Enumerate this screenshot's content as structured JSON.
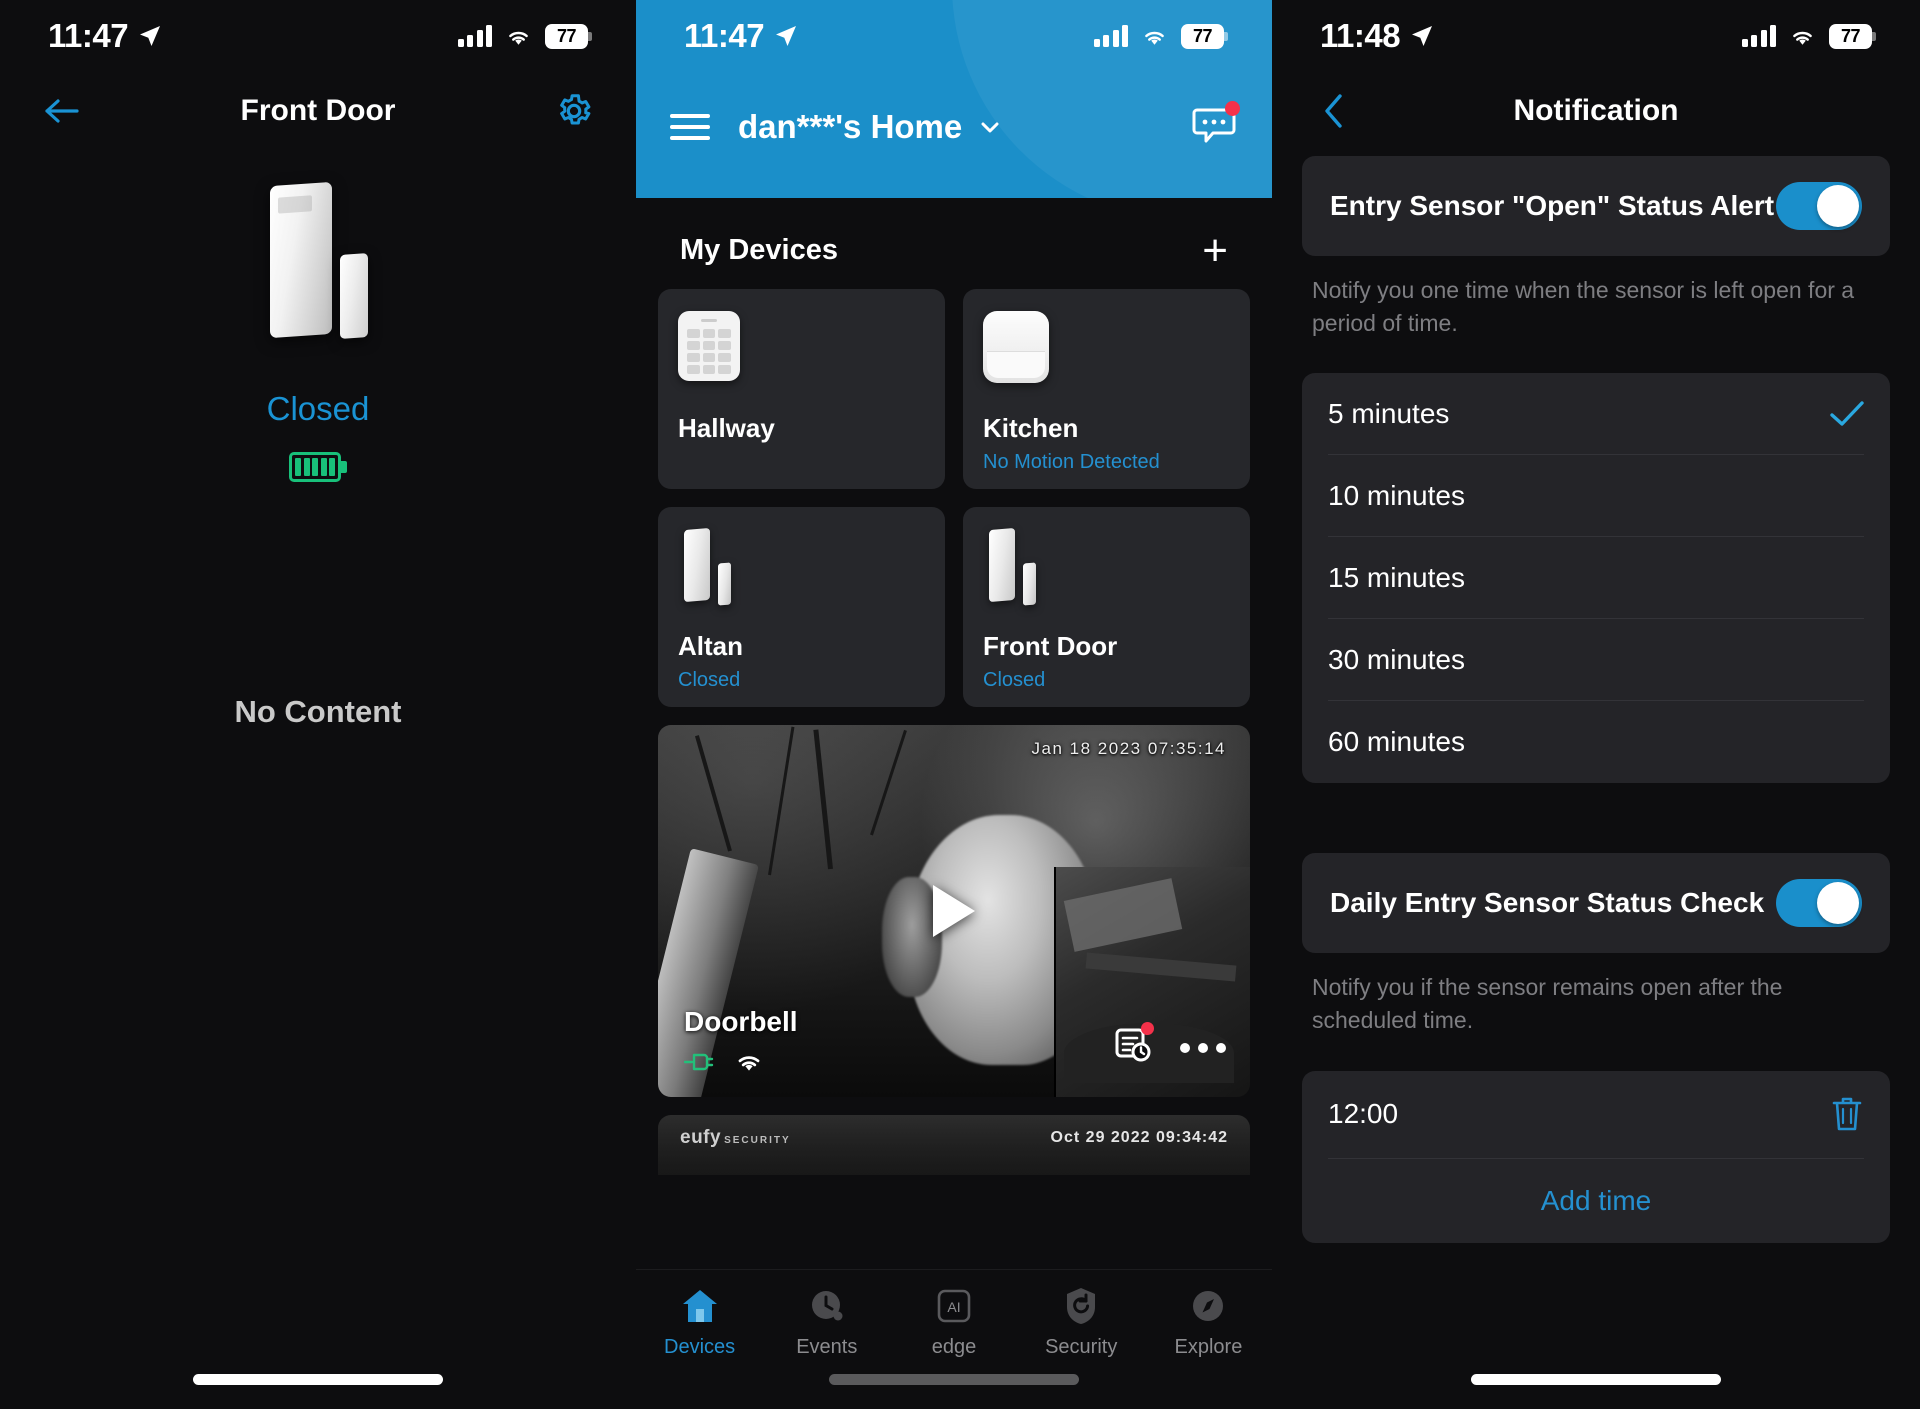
{
  "panel1": {
    "status": {
      "time": "11:47",
      "battery": "77"
    },
    "nav": {
      "title": "Front Door",
      "back_icon": "arrow-left-icon",
      "settings_icon": "gear-icon"
    },
    "device": {
      "image": "entry-sensor-image",
      "status": "Closed",
      "battery_icon": "battery-full-icon"
    },
    "empty_state": "No Content"
  },
  "panel2": {
    "status": {
      "time": "11:47",
      "battery": "77"
    },
    "header": {
      "menu_icon": "hamburger-icon",
      "home_name": "dan***'s Home",
      "chevron_icon": "chevron-down-icon",
      "message_icon": "message-icon",
      "message_badge": true
    },
    "section": {
      "title": "My Devices",
      "add_label": "+"
    },
    "devices": [
      {
        "name": "Hallway",
        "status": "",
        "icon": "keypad-icon"
      },
      {
        "name": "Kitchen",
        "status": "No Motion Detected",
        "icon": "motion-sensor-icon"
      },
      {
        "name": "Altan",
        "status": "Closed",
        "icon": "entry-sensor-icon"
      },
      {
        "name": "Front Door",
        "status": "Closed",
        "icon": "entry-sensor-icon"
      }
    ],
    "video": {
      "name": "Doorbell",
      "timestamp": "Jan 18 2023  07:35:14",
      "plug_icon": "plug-icon",
      "wifi_icon": "wifi-icon",
      "events_icon": "event-history-icon",
      "more_icon": "more-options-icon",
      "play_icon": "play-icon"
    },
    "next_clip": {
      "watermark": "eufy",
      "watermark_sub": "SECURITY",
      "timestamp": "Oct 29 2022   09:34:42"
    },
    "tabs": [
      {
        "label": "Devices",
        "icon": "home-icon",
        "active": true
      },
      {
        "label": "Events",
        "icon": "clock-icon",
        "active": false
      },
      {
        "label": "edge",
        "icon": "ai-icon",
        "active": false
      },
      {
        "label": "Security",
        "icon": "shield-icon",
        "active": false
      },
      {
        "label": "Explore",
        "icon": "compass-icon",
        "active": false
      }
    ]
  },
  "panel3": {
    "status": {
      "time": "11:48",
      "battery": "77"
    },
    "nav": {
      "title": "Notification",
      "back_icon": "chevron-left-icon"
    },
    "open_alert": {
      "label": "Entry Sensor \"Open\" Status Alert",
      "toggle_on": true,
      "hint": "Notify you one time when the sensor is left open for a period of time."
    },
    "duration_options": [
      {
        "label": "5 minutes",
        "selected": true
      },
      {
        "label": "10 minutes",
        "selected": false
      },
      {
        "label": "15 minutes",
        "selected": false
      },
      {
        "label": "30 minutes",
        "selected": false
      },
      {
        "label": "60 minutes",
        "selected": false
      }
    ],
    "daily_check": {
      "label": "Daily Entry Sensor Status Check",
      "toggle_on": true,
      "hint": "Notify you if the sensor remains open after the scheduled time."
    },
    "schedule": {
      "times": [
        {
          "value": "12:00",
          "delete_icon": "trash-icon"
        }
      ],
      "add_label": "Add time"
    }
  },
  "colors": {
    "accent_blue": "#2490d0",
    "header_blue": "#1b8fc9",
    "battery_green": "#18c07a",
    "badge_red": "#f4314a",
    "card_bg": "#26272b"
  }
}
